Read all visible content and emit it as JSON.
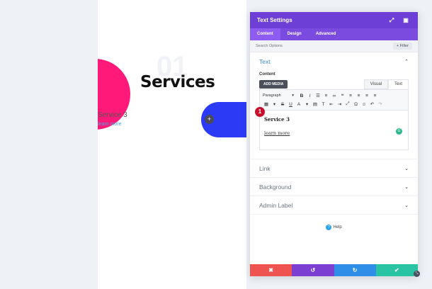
{
  "preview": {
    "number": "01",
    "title": "Services",
    "service_label": "Service 3",
    "link_label": "learn more",
    "add_icon": "+",
    "colors": {
      "pink": "#ff1a7a",
      "blue": "#2b3bf5"
    }
  },
  "panel": {
    "title": "Text Settings",
    "header_icons": {
      "expand": "⤢",
      "sidebar": "▣"
    },
    "tabs": [
      {
        "label": "Content",
        "active": true
      },
      {
        "label": "Design",
        "active": false
      },
      {
        "label": "Advanced",
        "active": false
      }
    ],
    "search": {
      "placeholder": "Search Options",
      "filter_label": "+ Filter"
    },
    "text_section": {
      "label": "Text",
      "content_label": "Content",
      "add_media": "ADD MEDIA",
      "modes": [
        "Visual",
        "Text"
      ],
      "paragraph_label": "Paragraph",
      "body_title": "Service 3",
      "body_link": "learn more",
      "step_badge": "1"
    },
    "collapsed_sections": [
      "Link",
      "Background",
      "Admin Label"
    ],
    "help_label": "Help",
    "help_icon": "?",
    "footer": {
      "cancel": "✖",
      "undo": "↺",
      "redo": "↻",
      "save": "✔",
      "colors": {
        "cancel": "#ef5350",
        "undo": "#7b3fd1",
        "redo": "#2e8ee8",
        "save": "#29c4a4"
      }
    },
    "accent": "#6e3fd6"
  }
}
